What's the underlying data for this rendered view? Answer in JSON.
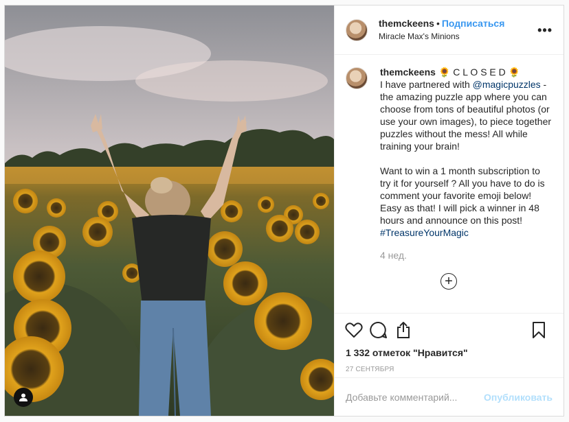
{
  "header": {
    "username": "themckeens",
    "dot": "•",
    "follow_label": "Подписаться",
    "location": "Miracle Max's Minions",
    "more_icon": "more-dots-icon"
  },
  "caption": {
    "username": "themckeens",
    "lead": "🌻 C L O S E D 🌻",
    "text1": "I have partnered with ",
    "mention": "@magicpuzzles",
    "text2": " - the amazing puzzle app where you can choose from tons of beautiful photos (or use your own images), to piece together puzzles without the mess! All while training your brain!",
    "text3": "Want to win a 1 month subscription to try it for yourself ? All you have to do is comment your favorite emoji below! Easy as that! I will pick a winner in 48 hours and announce on this post!",
    "hashtag": "#TreasureYourMagic",
    "age": "4 нед."
  },
  "load_more_icon": "plus-circle-icon",
  "actions": {
    "icons": [
      "heart-icon",
      "comment-icon",
      "share-icon",
      "bookmark-icon"
    ],
    "likes": "1 332 отметок \"Нравится\"",
    "date": "27 сентября"
  },
  "comment_box": {
    "placeholder": "Добавьте комментарий...",
    "publish_label": "Опубликовать"
  },
  "colors": {
    "link_blue": "#3897f0",
    "publish_disabled": "#b2dffc",
    "mention": "#003569"
  }
}
